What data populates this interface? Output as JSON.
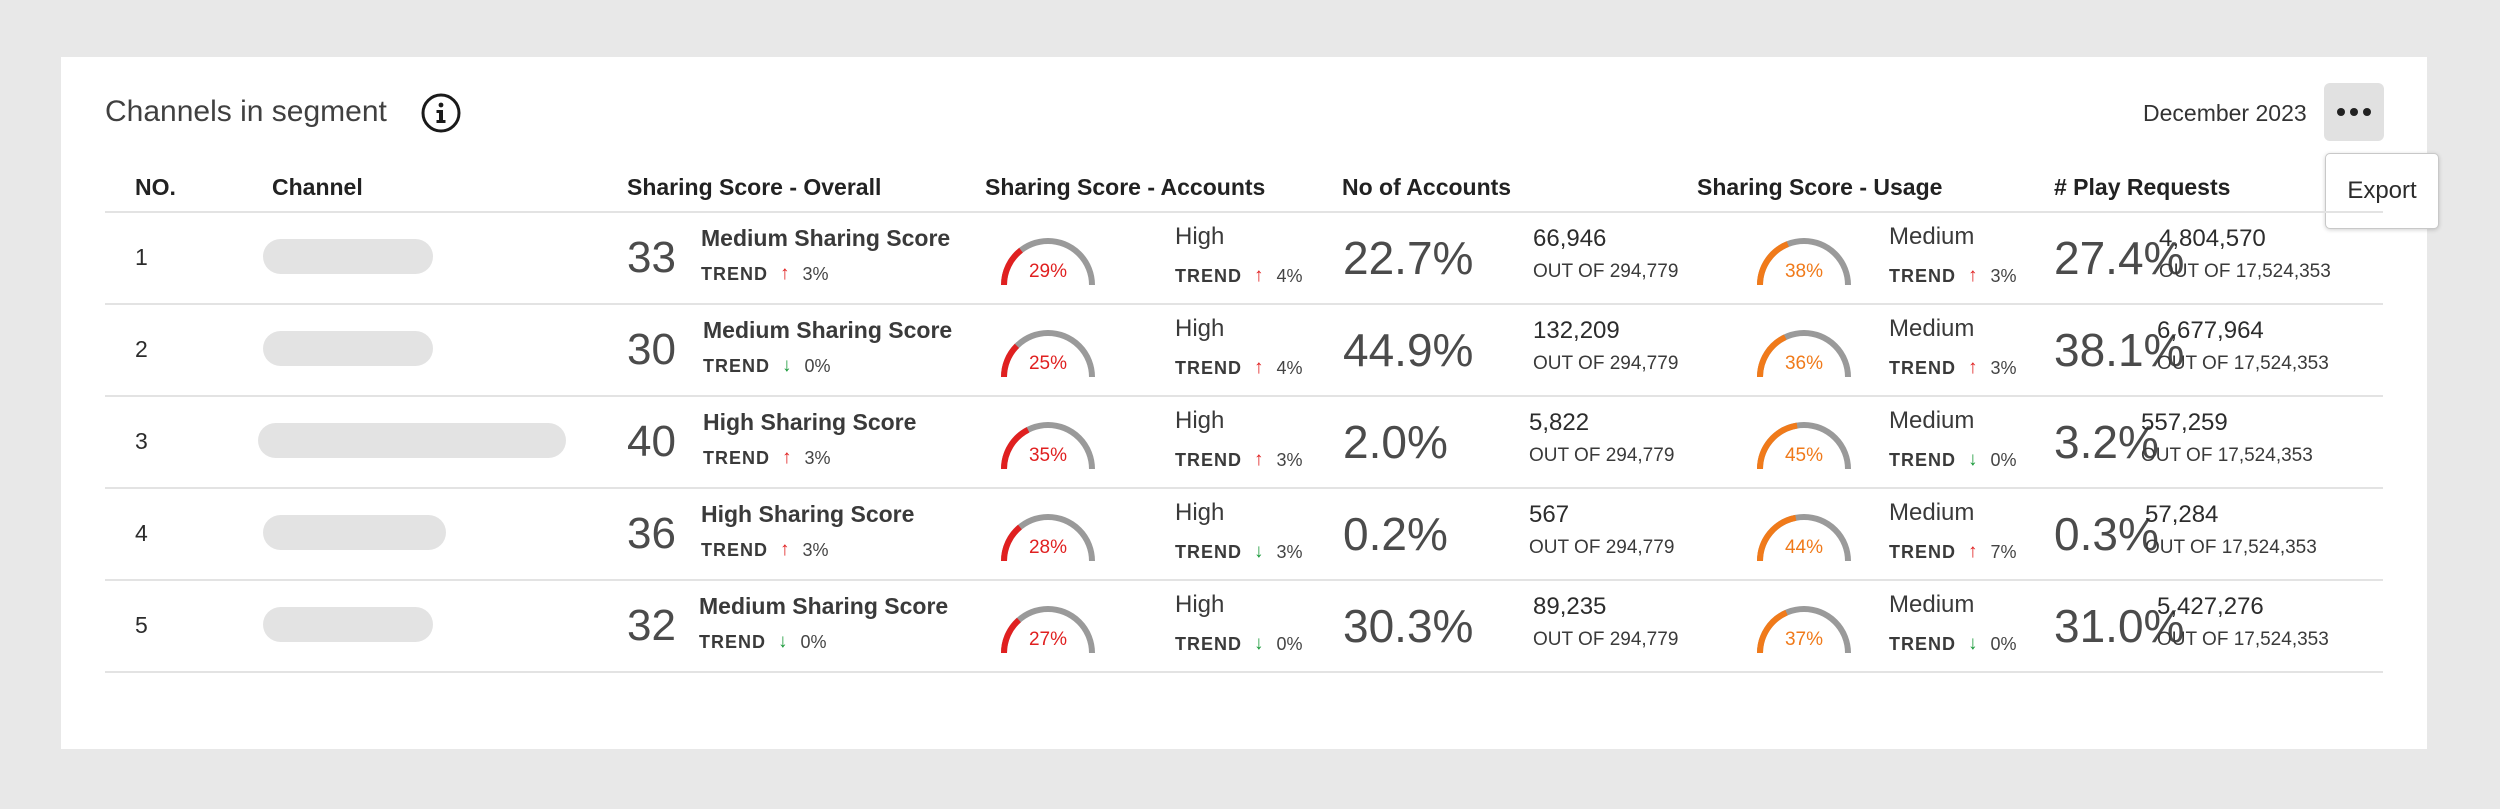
{
  "header": {
    "title": "Channels in segment",
    "date": "December 2023",
    "export_label": "Export"
  },
  "columns": [
    "NO.",
    "Channel",
    "Sharing Score - Overall",
    "Sharing Score - Accounts",
    "No of Accounts",
    "Sharing Score - Usage",
    "# Play Requests"
  ],
  "colors": {
    "accounts_gauge": "#e02020",
    "usage_gauge": "#f07a1a",
    "gauge_track": "#9a9a9a",
    "trend_up": "#e02020",
    "trend_down": "#1a9a3a"
  },
  "trend_label": "TREND",
  "rows": [
    {
      "no": "1",
      "overall": {
        "score": "33",
        "label": "Medium Sharing Score",
        "trend": "up",
        "arrow": "↑",
        "pct": "3%"
      },
      "accounts": {
        "gauge": "29%",
        "gauge_value": 0.29,
        "level": "High",
        "trend": "up",
        "arrow": "↑",
        "pct": "4%"
      },
      "num_accounts": {
        "pct": "22.7%",
        "count": "66,946",
        "out_of": "OUT OF 294,779"
      },
      "usage": {
        "gauge": "38%",
        "gauge_value": 0.38,
        "level": "Medium",
        "trend": "up",
        "arrow": "↑",
        "pct": "3%"
      },
      "play": {
        "pct": "27.4%",
        "count": "4,804,570",
        "out_of": "OUT OF 17,524,353"
      }
    },
    {
      "no": "2",
      "overall": {
        "score": "30",
        "label": "Medium Sharing Score",
        "trend": "down",
        "arrow": "↓",
        "pct": "0%"
      },
      "accounts": {
        "gauge": "25%",
        "gauge_value": 0.25,
        "level": "High",
        "trend": "up",
        "arrow": "↑",
        "pct": "4%"
      },
      "num_accounts": {
        "pct": "44.9%",
        "count": "132,209",
        "out_of": "OUT OF 294,779"
      },
      "usage": {
        "gauge": "36%",
        "gauge_value": 0.36,
        "level": "Medium",
        "trend": "up",
        "arrow": "↑",
        "pct": "3%"
      },
      "play": {
        "pct": "38.1%",
        "count": "6,677,964",
        "out_of": "OUT OF 17,524,353"
      }
    },
    {
      "no": "3",
      "overall": {
        "score": "40",
        "label": "High Sharing Score",
        "trend": "up",
        "arrow": "↑",
        "pct": "3%"
      },
      "accounts": {
        "gauge": "35%",
        "gauge_value": 0.35,
        "level": "High",
        "trend": "up",
        "arrow": "↑",
        "pct": "3%"
      },
      "num_accounts": {
        "pct": "2.0%",
        "count": "5,822",
        "out_of": "OUT OF 294,779"
      },
      "usage": {
        "gauge": "45%",
        "gauge_value": 0.45,
        "level": "Medium",
        "trend": "down",
        "arrow": "↓",
        "pct": "0%"
      },
      "play": {
        "pct": "3.2%",
        "count": "557,259",
        "out_of": "OUT OF 17,524,353"
      }
    },
    {
      "no": "4",
      "overall": {
        "score": "36",
        "label": "High Sharing Score",
        "trend": "up",
        "arrow": "↑",
        "pct": "3%"
      },
      "accounts": {
        "gauge": "28%",
        "gauge_value": 0.28,
        "level": "High",
        "trend": "down",
        "arrow": "↓",
        "pct": "3%"
      },
      "num_accounts": {
        "pct": "0.2%",
        "count": "567",
        "out_of": "OUT OF 294,779"
      },
      "usage": {
        "gauge": "44%",
        "gauge_value": 0.44,
        "level": "Medium",
        "trend": "up",
        "arrow": "↑",
        "pct": "7%"
      },
      "play": {
        "pct": "0.3%",
        "count": "57,284",
        "out_of": "OUT OF 17,524,353"
      }
    },
    {
      "no": "5",
      "overall": {
        "score": "32",
        "label": "Medium Sharing Score",
        "trend": "down",
        "arrow": "↓",
        "pct": "0%"
      },
      "accounts": {
        "gauge": "27%",
        "gauge_value": 0.27,
        "level": "High",
        "trend": "down",
        "arrow": "↓",
        "pct": "0%"
      },
      "num_accounts": {
        "pct": "30.3%",
        "count": "89,235",
        "out_of": "OUT OF 294,779"
      },
      "usage": {
        "gauge": "37%",
        "gauge_value": 0.37,
        "level": "Medium",
        "trend": "down",
        "arrow": "↓",
        "pct": "0%"
      },
      "play": {
        "pct": "31.0%",
        "count": "5,427,276",
        "out_of": "OUT OF 17,524,353"
      }
    }
  ]
}
